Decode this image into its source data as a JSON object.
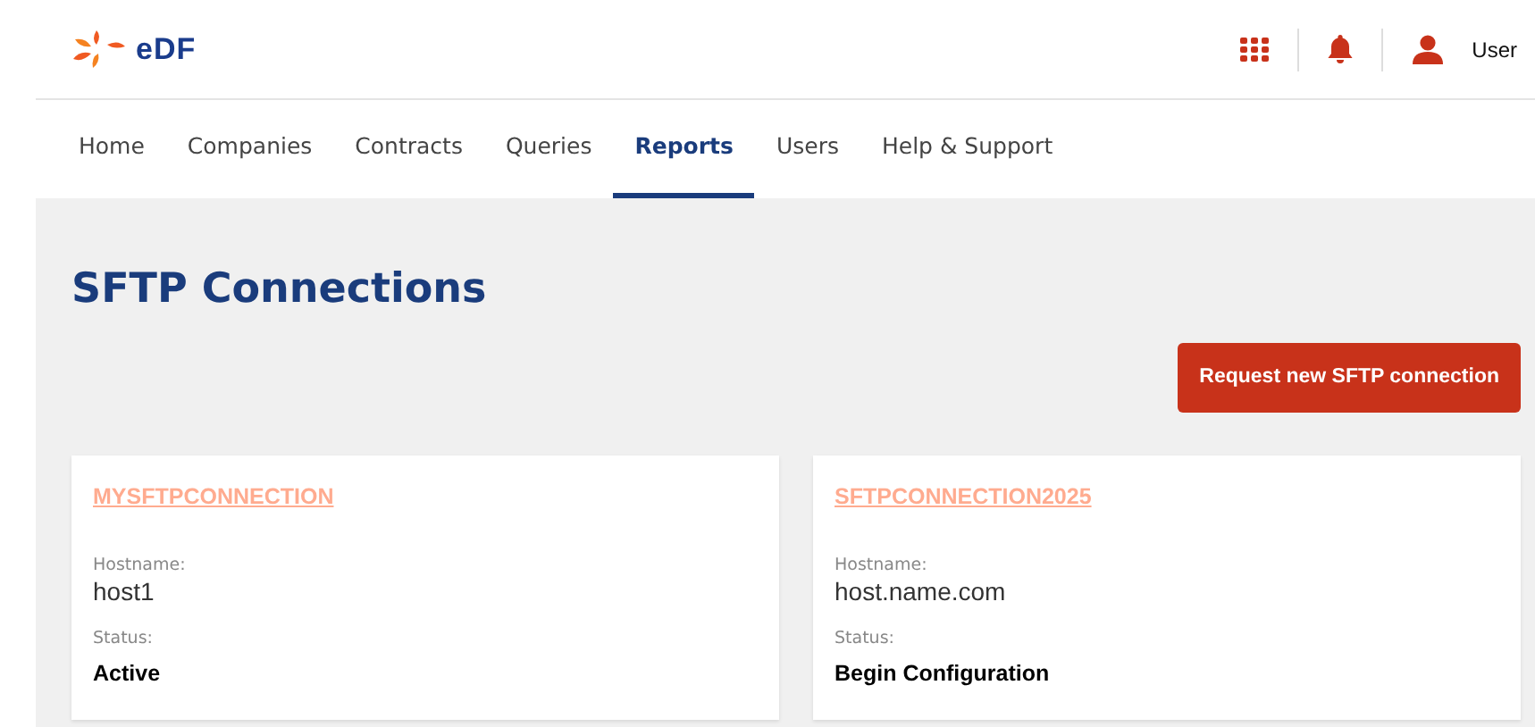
{
  "header": {
    "logo_text": "eDF",
    "user_label": "User"
  },
  "nav": [
    {
      "label": "Home",
      "selected": false
    },
    {
      "label": "Companies",
      "selected": false
    },
    {
      "label": "Contracts",
      "selected": false
    },
    {
      "label": "Queries",
      "selected": false
    },
    {
      "label": "Reports",
      "selected": true
    },
    {
      "label": "Users",
      "selected": false
    },
    {
      "label": "Help & Support",
      "selected": false
    }
  ],
  "page_title": "SFTP Connections",
  "request_button": "Request new SFTP connection",
  "connections": [
    {
      "name": "MYSFTPCONNECTION",
      "hostname_label": "Hostname:",
      "hostname": "host1",
      "status_label": "Status:",
      "status": "Active"
    },
    {
      "name": "SFTPCONNECTION2025",
      "hostname_label": "Hostname:",
      "hostname": "host.name.com",
      "status_label": "Status:",
      "status": "Begin Configuration"
    }
  ]
}
